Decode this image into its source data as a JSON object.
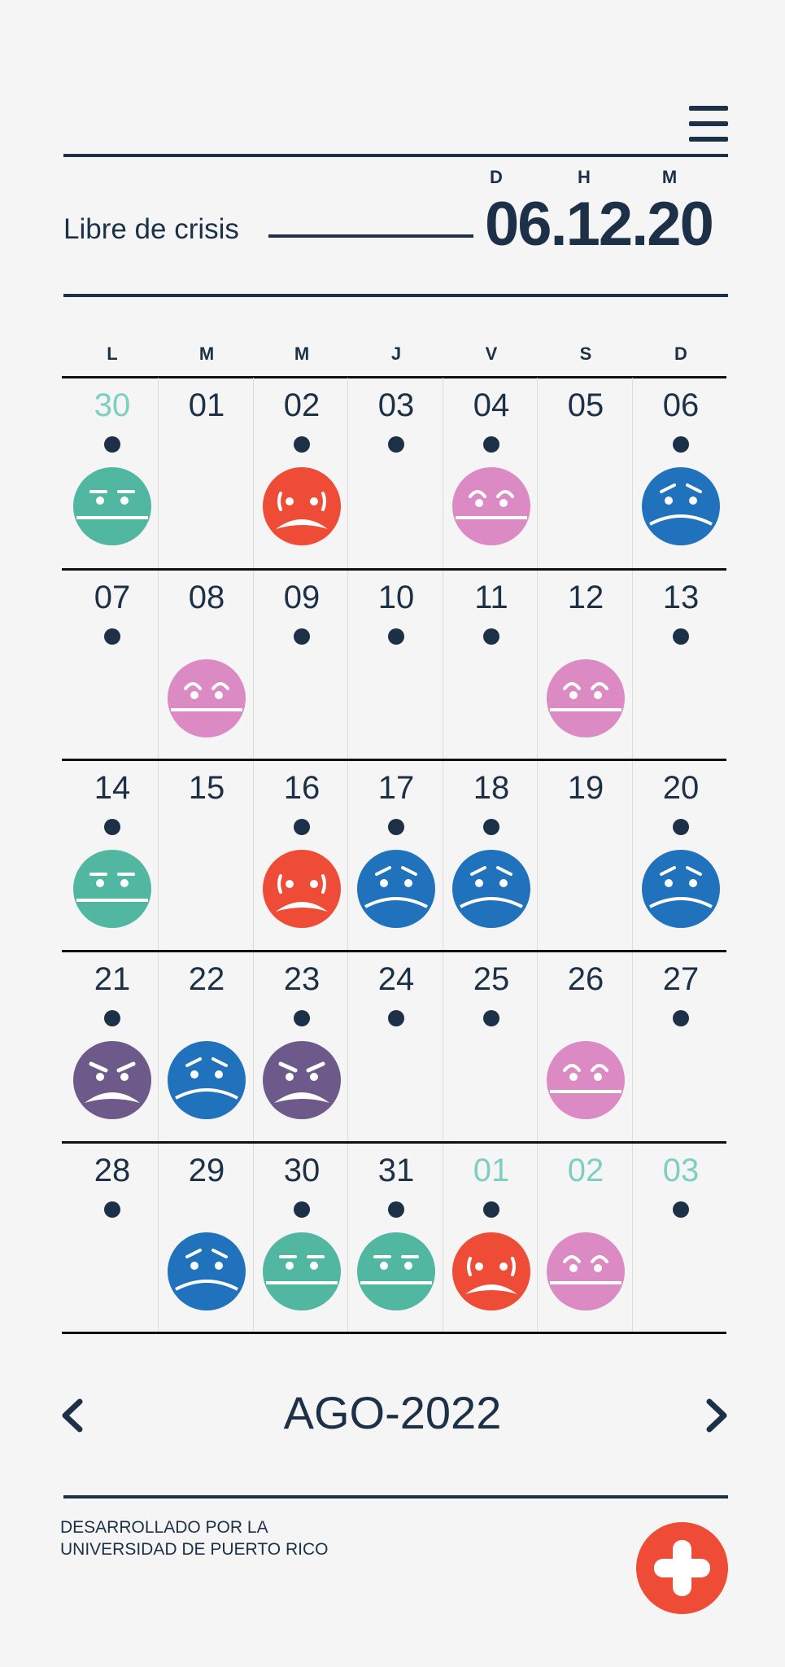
{
  "header": {
    "menu_icon": "hamburger-menu-icon",
    "crisis_label": "Libre de crisis",
    "counter_units": [
      "D",
      "H",
      "M"
    ],
    "counter_value": "06.12.20"
  },
  "calendar": {
    "weekdays": [
      "L",
      "M",
      "M",
      "J",
      "V",
      "S",
      "D"
    ],
    "weeks": [
      [
        {
          "day": "30",
          "other_month": true,
          "dot": true,
          "mood": "neutral"
        },
        {
          "day": "01",
          "dot": false,
          "mood": null
        },
        {
          "day": "02",
          "dot": true,
          "mood": "anxious"
        },
        {
          "day": "03",
          "dot": true,
          "mood": null
        },
        {
          "day": "04",
          "dot": true,
          "mood": "happy"
        },
        {
          "day": "05",
          "dot": false,
          "mood": null
        },
        {
          "day": "06",
          "dot": true,
          "mood": "sad"
        }
      ],
      [
        {
          "day": "07",
          "dot": true,
          "mood": null
        },
        {
          "day": "08",
          "dot": false,
          "mood": "happy"
        },
        {
          "day": "09",
          "dot": true,
          "mood": null
        },
        {
          "day": "10",
          "dot": true,
          "mood": null
        },
        {
          "day": "11",
          "dot": true,
          "mood": null
        },
        {
          "day": "12",
          "dot": false,
          "mood": "happy"
        },
        {
          "day": "13",
          "dot": true,
          "mood": null
        }
      ],
      [
        {
          "day": "14",
          "dot": true,
          "mood": "neutral"
        },
        {
          "day": "15",
          "dot": false,
          "mood": null
        },
        {
          "day": "16",
          "dot": true,
          "mood": "anxious"
        },
        {
          "day": "17",
          "dot": true,
          "mood": "sad"
        },
        {
          "day": "18",
          "dot": true,
          "mood": "sad"
        },
        {
          "day": "19",
          "dot": false,
          "mood": null
        },
        {
          "day": "20",
          "dot": true,
          "mood": "sad"
        }
      ],
      [
        {
          "day": "21",
          "dot": true,
          "mood": "angry"
        },
        {
          "day": "22",
          "dot": false,
          "mood": "sad"
        },
        {
          "day": "23",
          "dot": true,
          "mood": "angry"
        },
        {
          "day": "24",
          "dot": true,
          "mood": null
        },
        {
          "day": "25",
          "dot": true,
          "mood": null
        },
        {
          "day": "26",
          "dot": false,
          "mood": "happy"
        },
        {
          "day": "27",
          "dot": true,
          "mood": null
        }
      ],
      [
        {
          "day": "28",
          "dot": true,
          "mood": null
        },
        {
          "day": "29",
          "dot": false,
          "mood": "sad"
        },
        {
          "day": "30",
          "dot": true,
          "mood": "neutral"
        },
        {
          "day": "31",
          "dot": true,
          "mood": "neutral"
        },
        {
          "day": "01",
          "other_month": true,
          "dot": true,
          "mood": "anxious"
        },
        {
          "day": "02",
          "other_month": true,
          "dot": false,
          "mood": "happy"
        },
        {
          "day": "03",
          "other_month": true,
          "dot": true,
          "mood": null
        }
      ]
    ],
    "mood_colors": {
      "neutral": "#52b7a0",
      "anxious": "#ee4c36",
      "happy": "#dc8ac4",
      "sad": "#1f72bb",
      "angry": "#6d5a8a"
    },
    "mood_icons": {
      "neutral": "neutral-face-icon",
      "anxious": "anxious-face-icon",
      "happy": "happy-face-icon",
      "sad": "sad-face-icon",
      "angry": "angry-face-icon"
    }
  },
  "month_nav": {
    "prev_icon": "chevron-left-icon",
    "next_icon": "chevron-right-icon",
    "label": "AGO-2022"
  },
  "footer": {
    "credit_line1": "DESARROLLADO POR LA",
    "credit_line2": "UNIVERSIDAD DE PUERTO RICO",
    "add_icon": "plus-icon"
  },
  "colors": {
    "primary": "#1c3147",
    "other_month_day": "#7ecfbf",
    "fab": "#ee4c36",
    "background": "#f5f5f5"
  }
}
